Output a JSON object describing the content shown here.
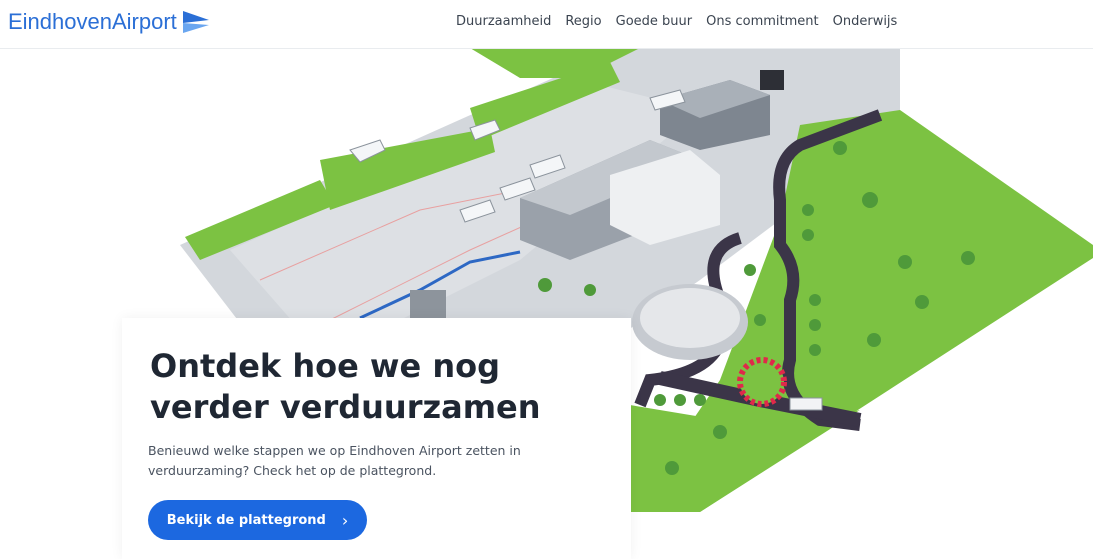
{
  "header": {
    "logo_text": "EindhovenAirport",
    "nav": [
      "Duurzaamheid",
      "Regio",
      "Goede buur",
      "Ons commitment",
      "Onderwijs"
    ]
  },
  "hero": {
    "title": "Ontdek hoe we nog verder verduurzamen",
    "text": "Benieuwd welke stappen we op Eindhoven Airport zetten in verduurzaming? Check het op de plattegrond.",
    "cta_label": "Bekijk de plattegrond"
  },
  "colors": {
    "brand_blue": "#1c68e0",
    "logo_blue": "#2b6fd6",
    "grass": "#7cc242",
    "apron": "#cfd3d8",
    "road": "#3b3548",
    "accent_red": "#e0294a"
  },
  "icons": [
    "airport-logo-icon",
    "chevron-right-icon"
  ]
}
